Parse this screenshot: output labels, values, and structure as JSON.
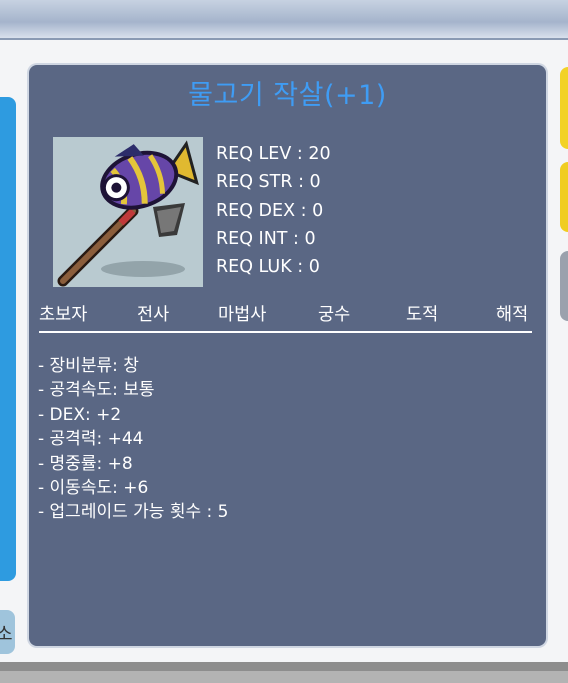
{
  "item": {
    "name": "물고기 작살(+1)",
    "requirements": [
      "REQ LEV : 20",
      "REQ STR : 0",
      "REQ DEX : 0",
      "REQ INT : 0",
      "REQ LUK : 0"
    ],
    "jobs": [
      "초보자",
      "전사",
      "마법사",
      "궁수",
      "도적",
      "해적"
    ],
    "stats": [
      "- 장비분류: 창",
      "- 공격속도: 보통",
      "- DEX: +2",
      "- 공격력: +44",
      "- 명중률: +8",
      "- 이동속도: +6",
      "- 업그레이드 가능 횟수 : 5"
    ]
  },
  "side": {
    "left_button_label": "소"
  },
  "colors": {
    "panel_bg": "#5a6784",
    "title": "#3f9cf4",
    "left_bar": "#2e9be0",
    "right_tab_yellow": "#f2d227"
  },
  "icons": {
    "item": "fish-spear-icon"
  }
}
